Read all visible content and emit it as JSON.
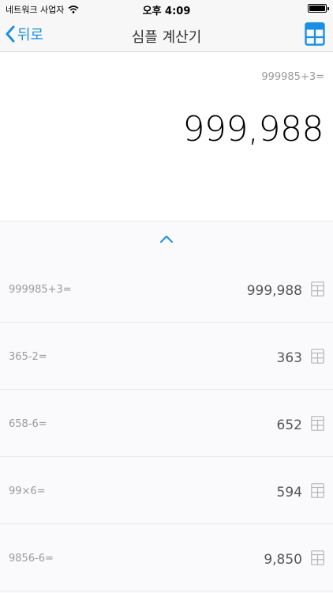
{
  "status_bar": {
    "carrier": "네트워크 사업자",
    "time": "오후 4:09",
    "icons": [
      "wifi-icon",
      "battery-icon"
    ]
  },
  "nav": {
    "back_label": "뒤로",
    "title": "심플 계산기",
    "right_icon": "calculator-icon"
  },
  "display": {
    "expression": "999985+3=",
    "result": "999,988"
  },
  "history": {
    "toggle_icon": "chevron-up-icon",
    "items": [
      {
        "expression": "999985+3=",
        "result": "999,988"
      },
      {
        "expression": "365-2=",
        "result": "363"
      },
      {
        "expression": "658-6=",
        "result": "652"
      },
      {
        "expression": "99×6=",
        "result": "594"
      },
      {
        "expression": "9856-6=",
        "result": "9,850"
      }
    ]
  },
  "colors": {
    "accent": "#1a8fe6",
    "bar_background": "#f7f7f7",
    "history_background": "#fafafd"
  }
}
